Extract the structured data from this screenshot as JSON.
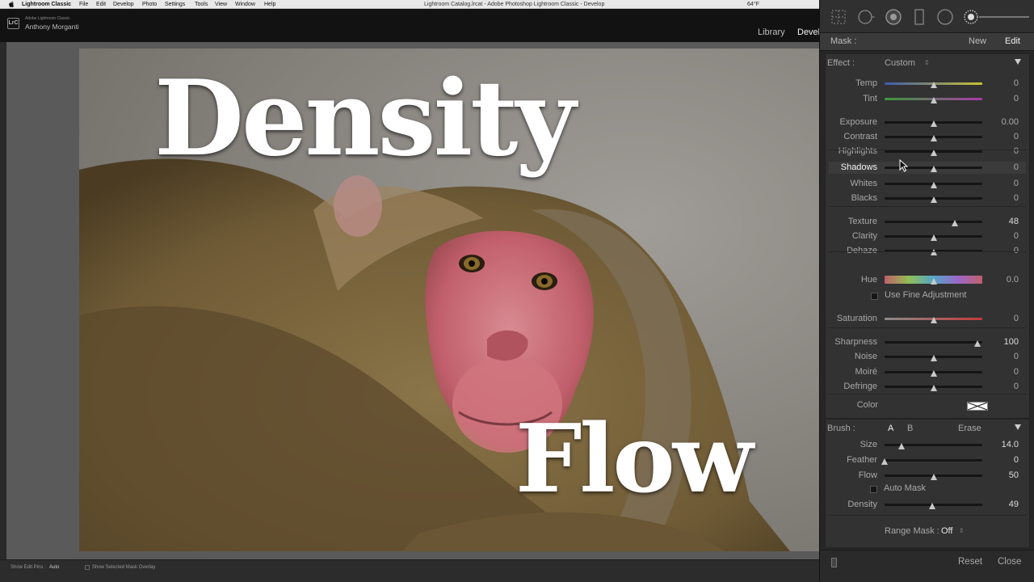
{
  "menubar": {
    "items": [
      "Lightroom Classic",
      "File",
      "Edit",
      "Develop",
      "Photo",
      "Settings",
      "Tools",
      "View",
      "Window",
      "Help"
    ],
    "window_title": "Lightroom Catalog.lrcat - Adobe Photoshop Lightroom Classic - Develop",
    "status": "64°F"
  },
  "identity": {
    "logo": "LrC",
    "product": "Adobe Lightroom Classic",
    "user": "Anthony Morganti"
  },
  "modules": {
    "library": "Library",
    "develop": "Devel"
  },
  "overlay": {
    "top_word": "Density",
    "bottom_word": "Flow"
  },
  "bottom_bar": {
    "edit_pins_label": "Show Edit Pins :",
    "edit_pins_value": "Auto",
    "mask_overlay_label": "Show Selected Mask Overlay"
  },
  "mask_header": {
    "label": "Mask :",
    "new": "New",
    "edit": "Edit"
  },
  "effect": {
    "label": "Effect :",
    "preset": "Custom",
    "sliders": [
      {
        "id": "temp",
        "label": "Temp",
        "value": "0",
        "pos": 0.5
      },
      {
        "id": "tint",
        "label": "Tint",
        "value": "0",
        "pos": 0.5
      },
      {
        "id": "exposure",
        "label": "Exposure",
        "value": "0.00",
        "pos": 0.5
      },
      {
        "id": "contrast",
        "label": "Contrast",
        "value": "0",
        "pos": 0.5
      },
      {
        "id": "highlights",
        "label": "Highlights",
        "value": "0",
        "pos": 0.5
      },
      {
        "id": "shadows",
        "label": "Shadows",
        "value": "0",
        "pos": 0.5
      },
      {
        "id": "whites",
        "label": "Whites",
        "value": "0",
        "pos": 0.5
      },
      {
        "id": "blacks",
        "label": "Blacks",
        "value": "0",
        "pos": 0.5
      },
      {
        "id": "texture",
        "label": "Texture",
        "value": "48",
        "pos": 0.72
      },
      {
        "id": "clarity",
        "label": "Clarity",
        "value": "0",
        "pos": 0.5
      },
      {
        "id": "dehaze",
        "label": "Dehaze",
        "value": "0",
        "pos": 0.5
      },
      {
        "id": "hue",
        "label": "Hue",
        "value": "0.0",
        "pos": 0.5
      },
      {
        "id": "saturation",
        "label": "Saturation",
        "value": "0",
        "pos": 0.5
      },
      {
        "id": "sharpness",
        "label": "Sharpness",
        "value": "100",
        "pos": 0.95
      },
      {
        "id": "noise",
        "label": "Noise",
        "value": "0",
        "pos": 0.5
      },
      {
        "id": "moire",
        "label": "Moiré",
        "value": "0",
        "pos": 0.5
      },
      {
        "id": "defringe",
        "label": "Defringe",
        "value": "0",
        "pos": 0.5
      }
    ],
    "fine_adjustment": "Use Fine Adjustment",
    "color_label": "Color"
  },
  "brush": {
    "label": "Brush :",
    "a": "A",
    "b": "B",
    "erase": "Erase",
    "sliders": [
      {
        "id": "size",
        "label": "Size",
        "value": "14.0",
        "pos": 0.17
      },
      {
        "id": "feather",
        "label": "Feather",
        "value": "0",
        "pos": 0.0
      },
      {
        "id": "flow",
        "label": "Flow",
        "value": "50",
        "pos": 0.5
      },
      {
        "id": "density",
        "label": "Density",
        "value": "49",
        "pos": 0.49
      }
    ],
    "auto_mask": "Auto Mask",
    "range_mask_label": "Range Mask :",
    "range_mask_value": "Off"
  },
  "footer": {
    "reset": "Reset",
    "close": "Close"
  },
  "colors": {
    "accent_text": "#f2f2f2",
    "panel_bg": "#323232",
    "temp_gradient": [
      "#3f5ab0",
      "#c9c12f"
    ],
    "tint_gradient": [
      "#3a9a3a",
      "#a93aa9"
    ],
    "hue_gradient": [
      "#c0606a",
      "#8fbf55",
      "#55a5c8",
      "#9a68c9",
      "#c0606a"
    ],
    "saturation_gradient": [
      "#8a8a8a",
      "#c63a3a"
    ]
  }
}
